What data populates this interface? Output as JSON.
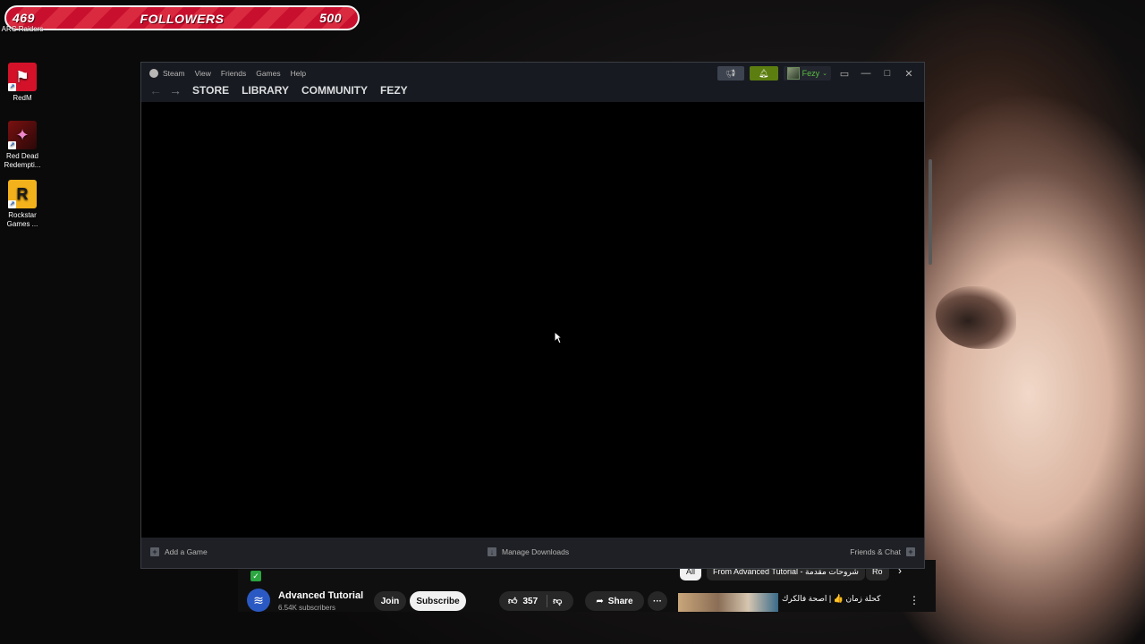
{
  "overlay": {
    "followers_current": "469",
    "followers_title": "FOLLOWERS",
    "followers_goal": "500"
  },
  "desktop": {
    "icons": [
      {
        "label": "ARC Raiders",
        "icon": "arc-raiders-icon"
      },
      {
        "label": "RedM",
        "icon": "redm-icon"
      },
      {
        "label": "Red Dead Redempti...",
        "icon": "red-dead-redemption-icon"
      },
      {
        "label": "Rockstar Games ...",
        "icon": "rockstar-games-icon"
      }
    ]
  },
  "steam": {
    "menu": [
      "Steam",
      "View",
      "Friends",
      "Games",
      "Help"
    ],
    "nav": [
      "STORE",
      "LIBRARY",
      "COMMUNITY",
      "FEZY"
    ],
    "user_name": "Fezy",
    "footer": {
      "add_game": "Add a Game",
      "manage_downloads": "Manage Downloads",
      "friends_chat": "Friends & Chat"
    },
    "colors": {
      "titlebar": "#171a21",
      "notification": "#5c7e10",
      "username": "#59bf40"
    }
  },
  "youtube": {
    "channel_name": "Advanced Tutorial",
    "subscribers": "6.54K subscribers",
    "join": "Join",
    "subscribe": "Subscribe",
    "likes": "357",
    "share": "Share",
    "chips": [
      "All",
      "From Advanced Tutorial - شروحات مقدمة",
      "Ro"
    ],
    "rec_title": "كحلة زمان 👍 | اصحة فالكرك"
  }
}
